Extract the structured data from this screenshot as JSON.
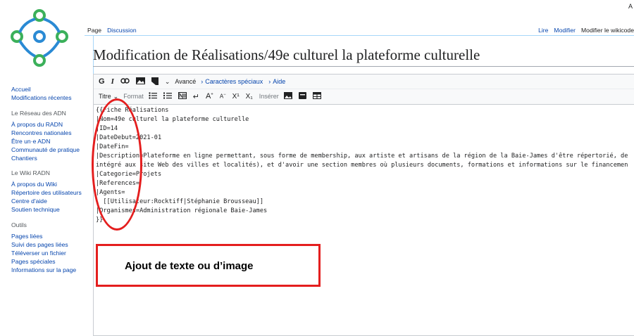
{
  "tabs": {
    "page": "Page",
    "discussion": "Discussion",
    "read": "Lire",
    "edit": "Modifier",
    "edit_wikicode": "Modifier le wikicode"
  },
  "sidebar": {
    "main": [
      "Accueil",
      "Modifications récentes"
    ],
    "section1": {
      "title": "Le Réseau des ADN",
      "items": [
        "À propos du RADN",
        "Rencontres nationales",
        "Être un·e ADN",
        "Communauté de pratique",
        "Chantiers"
      ]
    },
    "section2": {
      "title": "Le Wiki RADN",
      "items": [
        "À propos du Wiki",
        "Répertoire des utilisateurs",
        "Centre d'aide",
        "Soutien technique"
      ]
    },
    "section3": {
      "title": "Outils",
      "items": [
        "Pages liées",
        "Suivi des pages liées",
        "Téléverser un fichier",
        "Pages spéciales",
        "Informations sur la page"
      ]
    }
  },
  "page_title": "Modification de Réalisations/49e culturel la plateforme culturelle",
  "toolbar": {
    "bold": "G",
    "italic": "I",
    "advanced": "Avancé",
    "special_chars": "Caractères spéciaux",
    "help": "Aide",
    "heading": "Titre",
    "format": "Format",
    "superscript": "X¹",
    "subscript": "X₁",
    "insert": "Insérer"
  },
  "editor_lines": [
    "{{Fiche Réalisations",
    "|Nom=49e culturel la plateforme culturelle",
    "|ID=14",
    "|DateDebut=2021-01",
    "|DateFin=",
    "|Description=Plateforme en ligne permettant, sous forme de membership, aux artiste et artisans de la région de la Baie-James d'être répertorié, de",
    "intégré aux site Web des villes et localités), et d'avoir une section membres où plusieurs documents, formations et informations sur le financemen",
    "|Categorie=Projets",
    "|References=",
    "|Agents=",
    "  [[Utilisateur:Rocktiff|Stéphanie Brousseau]]",
    "|Organismes=Administration régionale Baie-James",
    "}}"
  ],
  "annotation": {
    "label": "Ajout de texte ou d’image",
    "color": "#e41e1e"
  },
  "corner_text": "A",
  "colors": {
    "link": "#0645ad",
    "accent": "#36c",
    "logo_green": "#3bb05a",
    "logo_blue": "#2a8ad4"
  }
}
